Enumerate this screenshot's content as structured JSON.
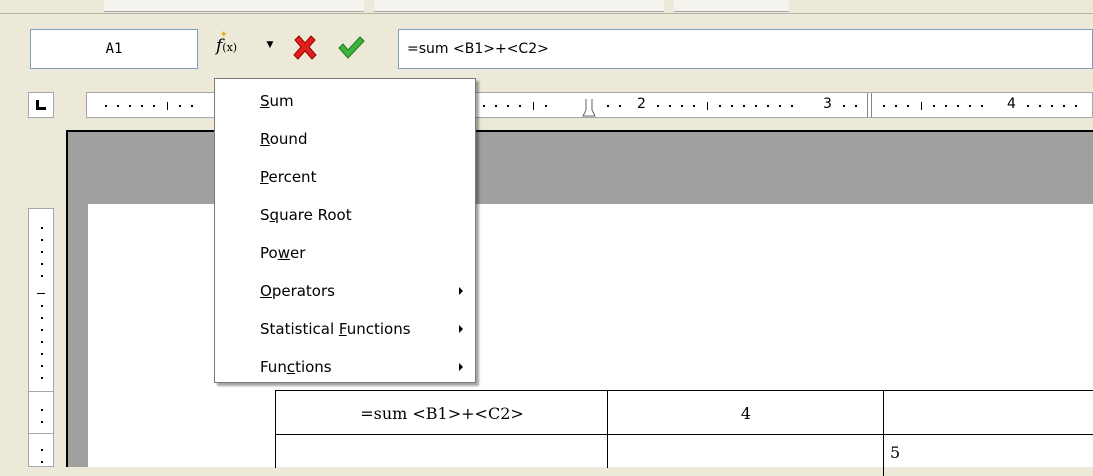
{
  "formula_bar": {
    "cell_reference": "A1",
    "formula": "=sum <B1>+<C2>",
    "function_icon": "fx-icon",
    "cancel_icon": "x-icon",
    "accept_icon": "checkmark-icon"
  },
  "ruler": {
    "numbers": [
      "2",
      "3",
      "4"
    ]
  },
  "menu": {
    "items": [
      {
        "label": "Sum",
        "mnemonic": "S",
        "submenu": false
      },
      {
        "label": "Round",
        "mnemonic": "R",
        "submenu": false
      },
      {
        "label": "Percent",
        "mnemonic": "P",
        "submenu": false
      },
      {
        "label": "Square Root",
        "mnemonic": "q",
        "submenu": false
      },
      {
        "label": "Power",
        "mnemonic": "w",
        "submenu": false
      },
      {
        "label": "Operators",
        "mnemonic": "O",
        "submenu": true
      },
      {
        "label": "Statistical Functions",
        "mnemonic": "F",
        "submenu": true
      },
      {
        "label": "Functions",
        "mnemonic": "c",
        "submenu": true
      }
    ]
  },
  "table": {
    "rows": [
      [
        "=sum <B1>+<C2>",
        "4",
        ""
      ],
      [
        "",
        "",
        "5"
      ]
    ]
  },
  "colors": {
    "toolbar_bg": "#ece9d8",
    "cancel": "#e02020",
    "accept": "#2fa82f",
    "doc_gray": "#a0a0a0"
  }
}
